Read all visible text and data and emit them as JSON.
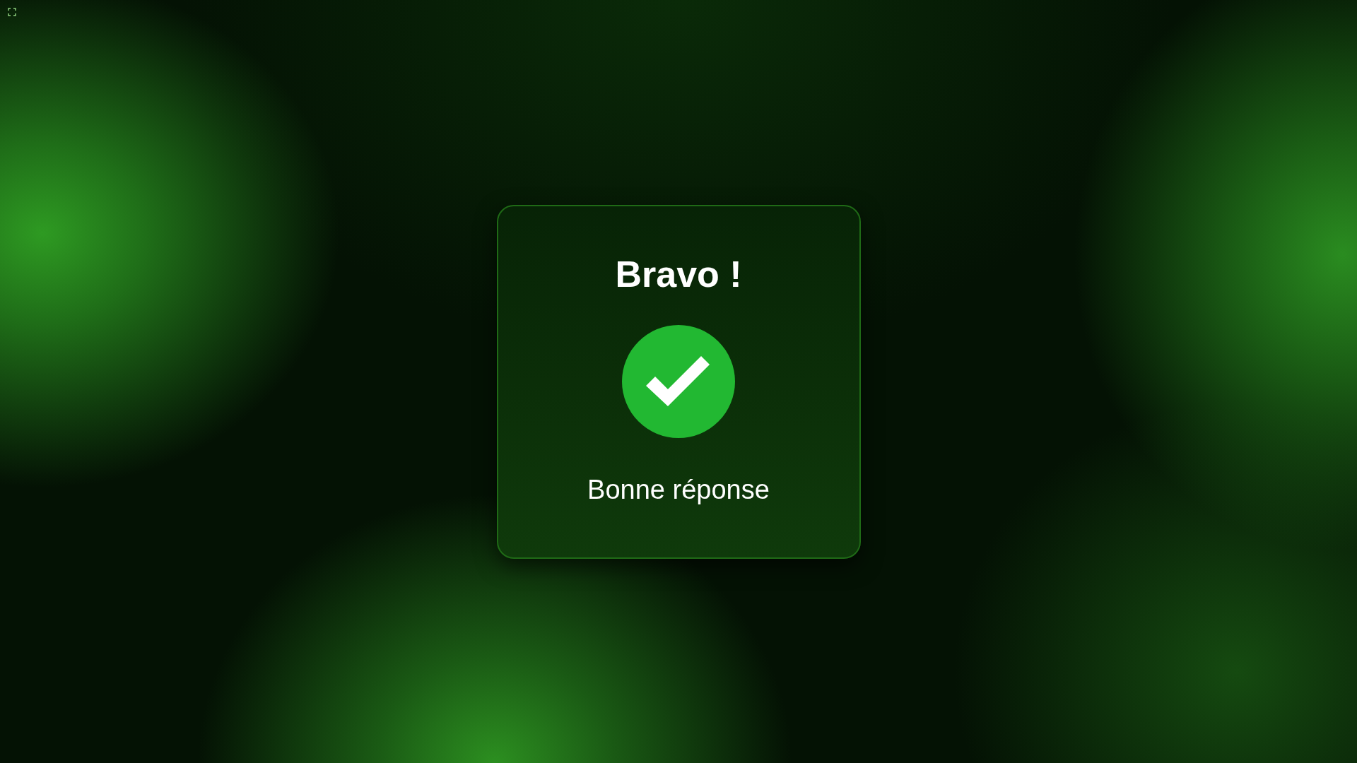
{
  "dialog": {
    "title": "Bravo !",
    "correct": true,
    "message": "Bonne réponse"
  }
}
